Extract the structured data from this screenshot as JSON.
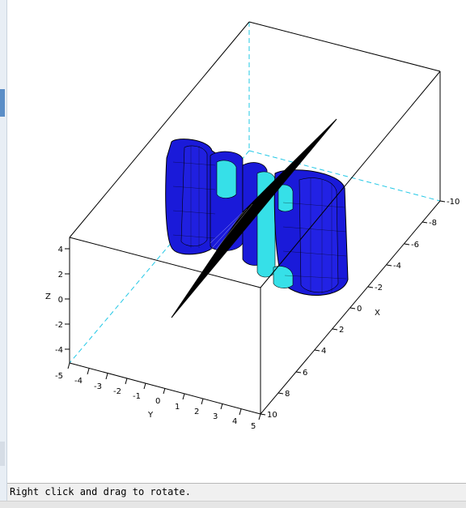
{
  "status_bar": {
    "message": "Right click and drag to rotate."
  },
  "plot": {
    "axes": {
      "x": {
        "label": "X",
        "ticks": [
          "-10",
          "-8",
          "-6",
          "-4",
          "-2",
          "0",
          "2",
          "4",
          "6",
          "8",
          "10"
        ]
      },
      "y": {
        "label": "Y",
        "ticks": [
          "-5",
          "-4",
          "-3",
          "-2",
          "-1",
          "0",
          "1",
          "2",
          "3",
          "4",
          "5"
        ]
      },
      "z": {
        "label": "Z",
        "ticks": [
          "4",
          "2",
          "0",
          "-2",
          "-4"
        ]
      }
    },
    "colors": {
      "surface": "#1a1ad9",
      "surface_inner": "#36e0e8",
      "edge": "#000000",
      "hidden_box_edge": "#22c8e6",
      "box_edge": "#000000"
    }
  }
}
